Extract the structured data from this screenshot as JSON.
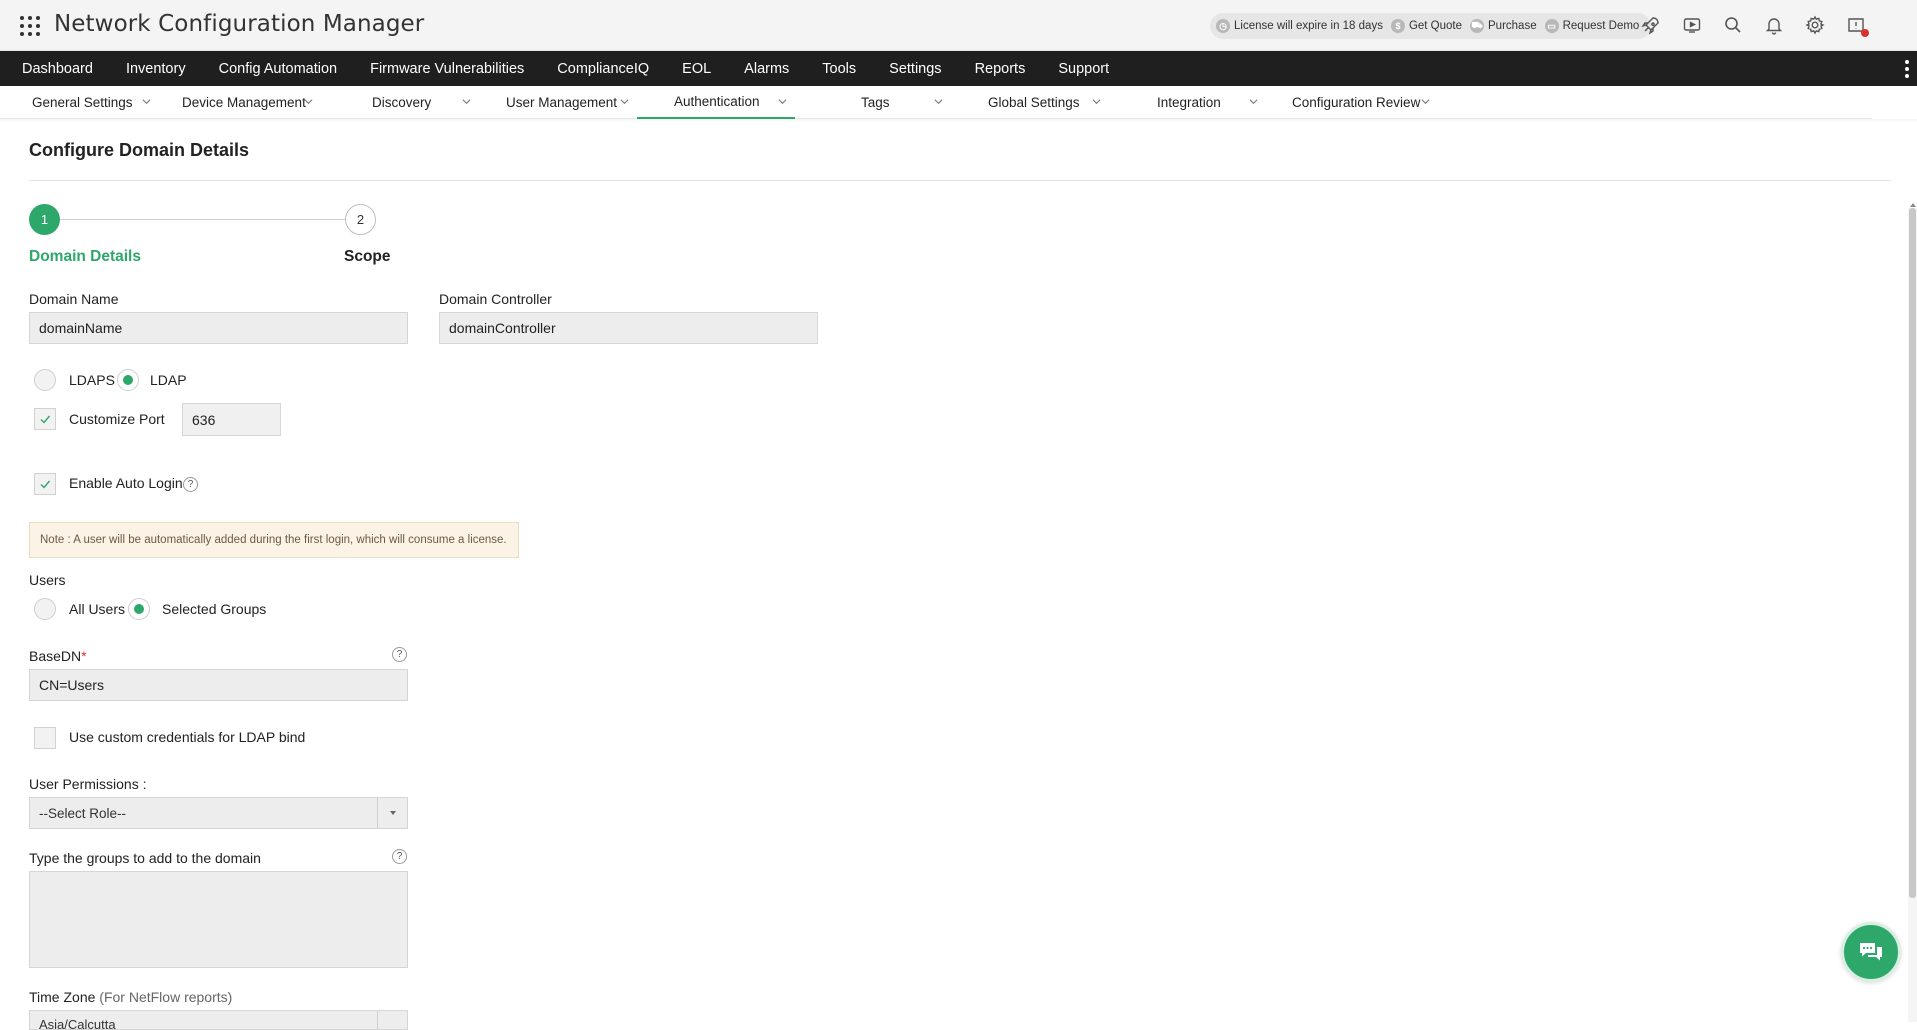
{
  "app": {
    "title": "Network Configuration Manager"
  },
  "header": {
    "license_text": "License will expire in 18 days",
    "get_quote": "Get Quote",
    "purchase": "Purchase",
    "request_demo": "Request Demo",
    "icons": [
      "rocket-icon",
      "video-icon",
      "search-icon",
      "bell-icon",
      "gear-icon",
      "alert-shield-icon"
    ]
  },
  "main_nav": {
    "items": [
      "Dashboard",
      "Inventory",
      "Config Automation",
      "Firmware Vulnerabilities",
      "ComplianceIQ",
      "EOL",
      "Alarms",
      "Tools",
      "Settings",
      "Reports",
      "Support"
    ]
  },
  "sub_nav": {
    "items": [
      "General Settings",
      "Device Management",
      "Discovery",
      "User Management",
      "Authentication",
      "Tags",
      "Global Settings",
      "Integration",
      "Configuration Review"
    ],
    "active": "Authentication"
  },
  "page": {
    "title": "Configure Domain Details",
    "steps": [
      {
        "number": "1",
        "label": "Domain Details",
        "active": true
      },
      {
        "number": "2",
        "label": "Scope",
        "active": false
      }
    ]
  },
  "form": {
    "domain_name_label": "Domain Name",
    "domain_name_value": "domainName",
    "domain_controller_label": "Domain Controller",
    "domain_controller_value": "domainController",
    "protocol_ldaps": "LDAPS",
    "protocol_ldap": "LDAP",
    "protocol_selected": "LDAP",
    "customize_port_label": "Customize Port",
    "customize_port_checked": true,
    "port_value": "636",
    "auto_login_label": "Enable Auto Login",
    "auto_login_checked": true,
    "help_glyph": "?",
    "note": "Note : A user will be automatically added during the first login, which will consume a license.",
    "users_label": "Users",
    "users_all": "All Users",
    "users_selected_groups": "Selected Groups",
    "users_selected": "Selected Groups",
    "basedn_label": "BaseDN",
    "required_marker": "*",
    "basedn_value": "CN=Users",
    "custom_credentials_label": "Use custom credentials for LDAP bind",
    "custom_credentials_checked": false,
    "user_permissions_label": "User Permissions :",
    "user_permissions_value": "--Select Role--",
    "groups_label": "Type the groups to add to the domain",
    "groups_value": "",
    "timezone_label": "Time Zone",
    "timezone_hint": "(For NetFlow reports)",
    "timezone_value": "Asia/Calcutta"
  },
  "colors": {
    "accent": "#2ea76a",
    "nav_bg": "#1f1f1f",
    "note_bg": "#fbf3e6",
    "alert_red": "#d9302c"
  }
}
